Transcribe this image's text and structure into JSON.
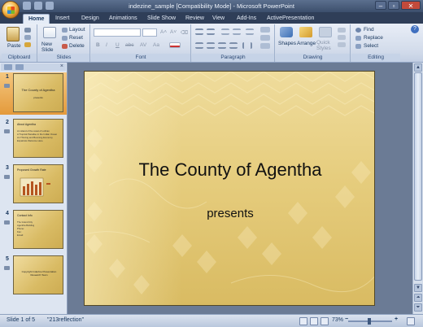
{
  "window": {
    "title": "indezine_sample [Compatibility Mode] - Microsoft PowerPoint",
    "controls": {
      "minimize": "‒",
      "maximize": "▫",
      "close": "✕"
    }
  },
  "tabs": [
    "Home",
    "Insert",
    "Design",
    "Animations",
    "Slide Show",
    "Review",
    "View",
    "Add-Ins",
    "ActivePresentation"
  ],
  "ribbon": {
    "clipboard": {
      "label": "Clipboard",
      "paste": "Paste"
    },
    "slides": {
      "label": "Slides",
      "new_slide": "New Slide",
      "layout": "Layout",
      "reset": "Reset",
      "delete": "Delete"
    },
    "font": {
      "label": "Font",
      "bold": "B",
      "italic": "I",
      "underline": "U",
      "strike": "abc",
      "spacing": "AV",
      "case": "Aa"
    },
    "paragraph": {
      "label": "Paragraph"
    },
    "drawing": {
      "label": "Drawing",
      "shapes": "Shapes",
      "arrange": "Arrange",
      "quick_styles": "Quick Styles"
    },
    "editing": {
      "label": "Editing",
      "find": "Find",
      "replace": "Replace",
      "select": "Select"
    }
  },
  "slides": [
    {
      "number": "1",
      "title": "The County of Agentha",
      "subtitle": "presents"
    },
    {
      "number": "2",
      "title": "About Agentha",
      "bullets": [
        "An island of the coast of Lothian",
        "A Tropical Paradise in the Indian Ocean",
        "An Thriving and Booming Economy",
        "Expatriots Welcome Here"
      ]
    },
    {
      "number": "3",
      "title": "Proposed Growth Rate"
    },
    {
      "number": "4",
      "title": "Contact Info",
      "bullets": [
        "The Grand City",
        "Agentha Building",
        "Phone:",
        "Fax:",
        "Email:"
      ]
    },
    {
      "number": "5",
      "title": "Copyright Indezine Presentation Research Team"
    }
  ],
  "main_slide": {
    "title": "The County of Agentha",
    "subtitle": "presents"
  },
  "status": {
    "slide_info": "Slide 1 of 5",
    "theme": "\"213reflection\"",
    "zoom": "73%"
  },
  "colors": {
    "accent_orange": "#e49a3b",
    "slide_gold": "#e6cd7e",
    "chart_bar": "#b5541f"
  }
}
